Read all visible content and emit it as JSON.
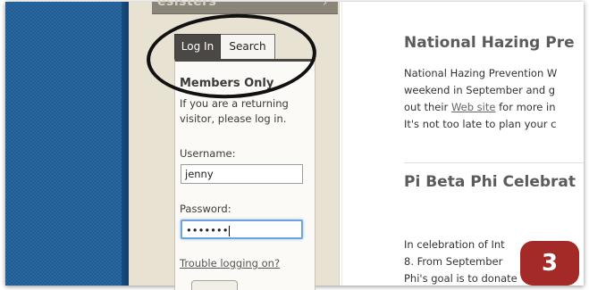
{
  "sidebar": {
    "header_text": "esisters",
    "header_arrow": "›"
  },
  "login_widget": {
    "tabs": [
      {
        "label": "Log In",
        "active": true
      },
      {
        "label": "Search",
        "active": false
      }
    ],
    "title": "Members Only",
    "intro_line_1": "If you are a returning",
    "intro_line_2": "visitor, please log in.",
    "username_label": "Username:",
    "username_value": "jenny",
    "password_label": "Password:",
    "password_value": "•••••••",
    "trouble_link": "Trouble logging on?"
  },
  "articles": [
    {
      "title": "National Hazing Pre",
      "lines": [
        "National Hazing Prevention W",
        "weekend in September and g",
        "out their ",
        " for more in",
        "It's not too late to plan your c"
      ],
      "link_text": "Web site"
    },
    {
      "title": "Pi Beta Phi Celebrat",
      "lines": [
        "In celebration of Int",
        "8. From September",
        "Phi's goal is to donate"
      ]
    }
  ],
  "step_badge": "3",
  "colors": {
    "background_blue": "#1f5d97",
    "sidebar_beige": "#e8e2d3",
    "active_tab": "#4a4744",
    "focus_blue": "#6fa3dc",
    "badge_red": "#a32a27"
  },
  "icons": {
    "header_arrow": "chevron-right-icon"
  }
}
